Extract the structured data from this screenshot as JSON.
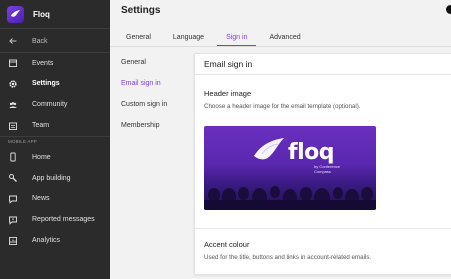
{
  "app": {
    "name": "Floq"
  },
  "sidebar": {
    "back_label": "Back",
    "items": [
      {
        "label": "Events",
        "icon": "calendar-icon"
      },
      {
        "label": "Settings",
        "icon": "gear-icon"
      },
      {
        "label": "Community",
        "icon": "people-icon"
      },
      {
        "label": "Team",
        "icon": "team-icon"
      }
    ],
    "section_label": "MOBILE APP",
    "app_items": [
      {
        "label": "Home",
        "icon": "phone-icon"
      },
      {
        "label": "App building",
        "icon": "wrench-icon"
      },
      {
        "label": "News",
        "icon": "news-icon"
      },
      {
        "label": "Reported messages",
        "icon": "flag-icon"
      },
      {
        "label": "Analytics",
        "icon": "analytics-icon"
      }
    ],
    "active": "Settings"
  },
  "header": {
    "title": "Settings",
    "tabs": [
      "General",
      "Language",
      "Sign in",
      "Advanced"
    ],
    "active_tab": "Sign in"
  },
  "subnav": {
    "items": [
      "General",
      "Email sign in",
      "Custom sign in",
      "Membership"
    ],
    "active": "Email sign in"
  },
  "card": {
    "title": "Email sign in",
    "header_image": {
      "title": "Header image",
      "description": "Choose a header image for the email template (optional).",
      "logo_text": "floq",
      "logo_by": "by Conference",
      "logo_by2": "Compass"
    },
    "accent": {
      "title": "Accent colour",
      "description": "Used for the title, buttons and links in account-related emails."
    }
  },
  "colors": {
    "accent": "#7b3fe4",
    "sidebar_bg": "#2b2b2b"
  }
}
